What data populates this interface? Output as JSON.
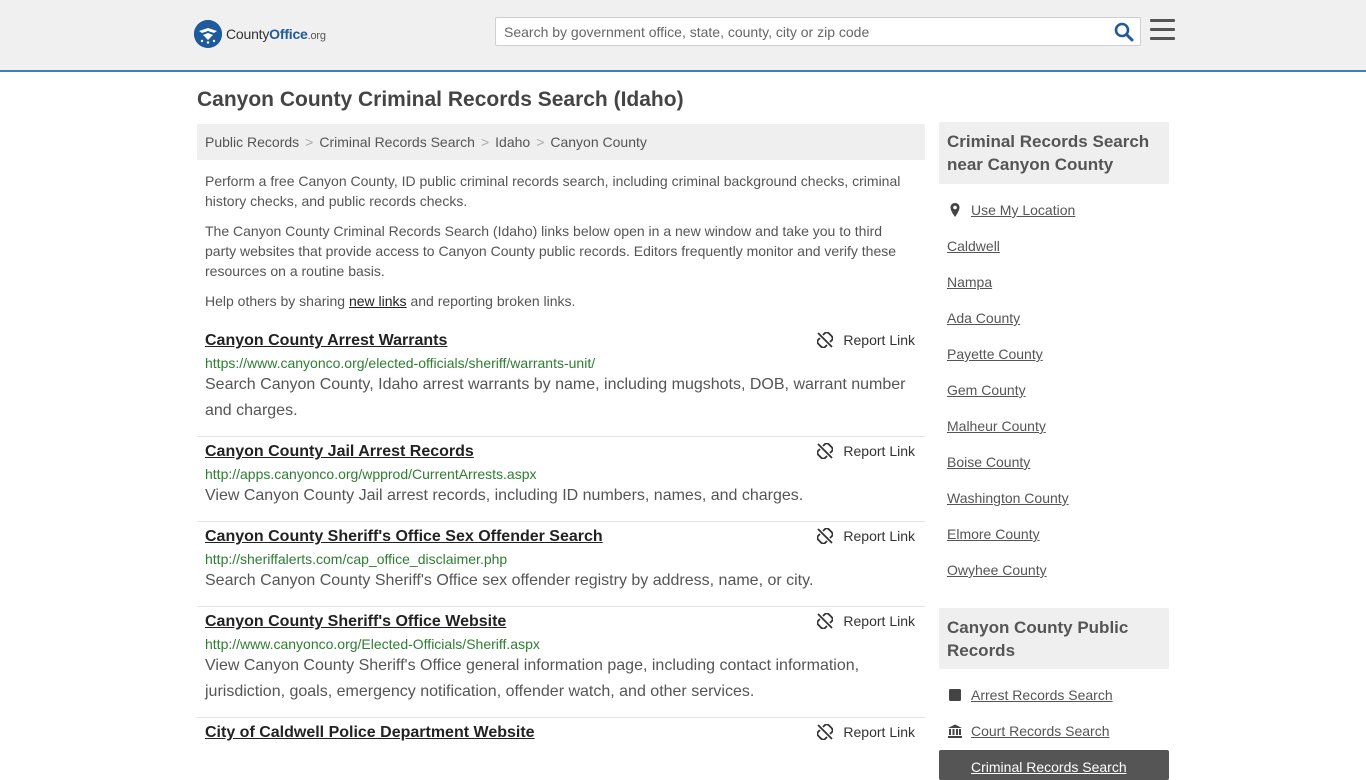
{
  "header": {
    "logo": {
      "county": "County",
      "office": "Office",
      "tld": ".org"
    },
    "search_placeholder": "Search by government office, state, county, city or zip code"
  },
  "page_title": "Canyon County Criminal Records Search (Idaho)",
  "breadcrumb": [
    "Public Records",
    "Criminal Records Search",
    "Idaho",
    "Canyon County"
  ],
  "intro": {
    "p1": "Perform a free Canyon County, ID public criminal records search, including criminal background checks, criminal history checks, and public records checks.",
    "p2": "The Canyon County Criminal Records Search (Idaho) links below open in a new window and take you to third party websites that provide access to Canyon County public records. Editors frequently monitor and verify these resources on a routine basis.",
    "p3_before": "Help others by sharing ",
    "p3_link": "new links",
    "p3_after": " and reporting broken links."
  },
  "report_label": "Report Link",
  "results": [
    {
      "title": "Canyon County Arrest Warrants",
      "url": "https://www.canyonco.org/elected-officials/sheriff/warrants-unit/",
      "desc": "Search Canyon County, Idaho arrest warrants by name, including mugshots, DOB, warrant number and charges."
    },
    {
      "title": "Canyon County Jail Arrest Records",
      "url": "http://apps.canyonco.org/wpprod/CurrentArrests.aspx",
      "desc": "View Canyon County Jail arrest records, including ID numbers, names, and charges."
    },
    {
      "title": "Canyon County Sheriff's Office Sex Offender Search",
      "url": "http://sheriffalerts.com/cap_office_disclaimer.php",
      "desc": "Search Canyon County Sheriff's Office sex offender registry by address, name, or city."
    },
    {
      "title": "Canyon County Sheriff's Office Website",
      "url": "http://www.canyonco.org/Elected-Officials/Sheriff.aspx",
      "desc": "View Canyon County Sheriff's Office general information page, including contact information, jurisdiction, goals, emergency notification, offender watch, and other services."
    },
    {
      "title": "City of Caldwell Police Department Website",
      "url": "",
      "desc": ""
    }
  ],
  "sidebar": {
    "nearby_heading": "Criminal Records Search near Canyon County",
    "use_location": "Use My Location",
    "nearby": [
      "Caldwell",
      "Nampa",
      "Ada County",
      "Payette County",
      "Gem County",
      "Malheur County",
      "Boise County",
      "Washington County",
      "Elmore County",
      "Owyhee County"
    ],
    "public_heading": "Canyon County Public Records",
    "public": [
      "Arrest Records Search",
      "Court Records Search"
    ],
    "active": "Criminal Records Search"
  }
}
